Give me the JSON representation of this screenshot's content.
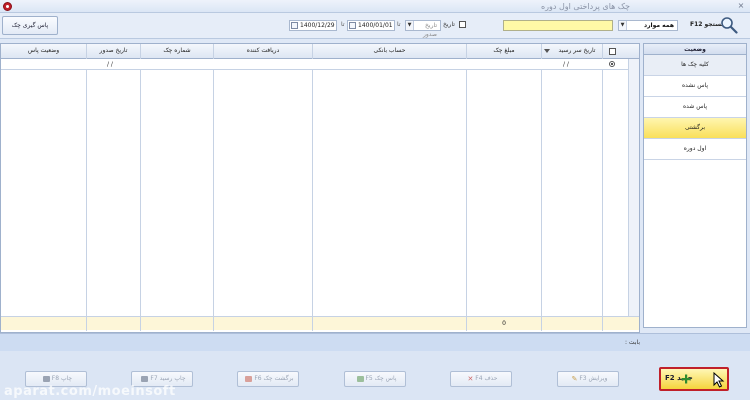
{
  "window": {
    "title": "چک های پرداختی اول دوره",
    "close_glyph": "×"
  },
  "toolbar": {
    "clearing_button": "پاس گیری چک",
    "date_to": "1400/12/29",
    "date_from": "1400/01/01",
    "to_label": "تا",
    "issue_date_combo": "تاریخ صدور",
    "issue_date_checkbox": "تاریخ",
    "all_items_combo": "همه موارد",
    "search_label": "جستجو F12",
    "search_value": ""
  },
  "status_panel": {
    "header": "وضعیت",
    "items": [
      {
        "label": "کلیه چک ها"
      },
      {
        "label": "پاس نشده"
      },
      {
        "label": "پاس شده"
      },
      {
        "label": "برگشتی"
      },
      {
        "label": "اول دوره"
      }
    ]
  },
  "grid": {
    "columns": [
      "وضعیت پاس",
      "تاریخ صدور",
      "شماره چک",
      "دریافت کننده",
      "حساب بانکی",
      "مبلغ چک",
      "تاریخ سر رسید"
    ],
    "filter_row": {
      "issue_date": "/  /",
      "due_date": "/  /"
    },
    "footer_sum": "0"
  },
  "info": {
    "label": "بابت :"
  },
  "buttons": {
    "print": "چاپ F8",
    "print_receipt": "چاپ رسید F7",
    "return_check": "برگشت چک F6",
    "pass_check": "پاس چک F5",
    "delete": "حذف F4",
    "edit": "ویرایش F3",
    "new": "جدید F2"
  },
  "watermark": "aparat.com/moeinsoft",
  "colors": {
    "accent_highlight": "#c0202a",
    "new_button": "#f5d43c",
    "search_field": "#fff9a6"
  }
}
